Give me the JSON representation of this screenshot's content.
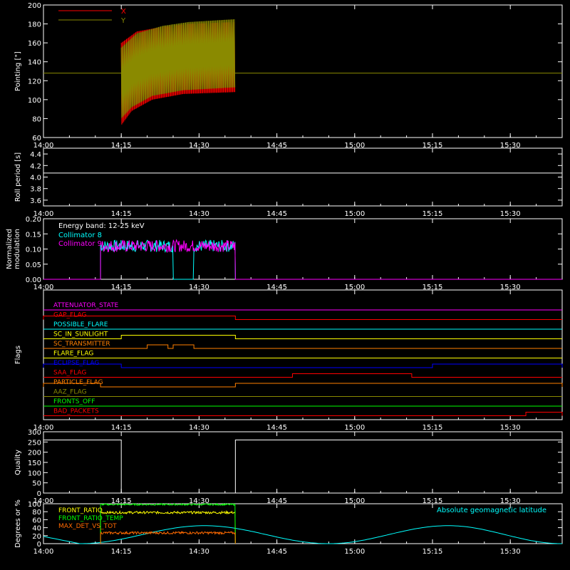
{
  "time_axis": {
    "start": "14:00",
    "end": "15:40",
    "tick_labels": [
      "14:00",
      "14:15",
      "14:30",
      "14:45",
      "15:00",
      "15:15",
      "15:30"
    ]
  },
  "colors": {
    "axis": "#ffffff",
    "red": "#ff0000",
    "olive": "#8a8a00",
    "cyan": "#00ffff",
    "magenta": "#ff00ff",
    "white": "#ffffff",
    "orange": "#ff7f00",
    "yellow": "#ffff00",
    "blue": "#0000ff",
    "green": "#00ff00",
    "dark_orange": "#ff6a00"
  },
  "chart_data": [
    {
      "type": "line",
      "ylabel": "Pointing [\"]",
      "ylim": [
        60,
        200
      ],
      "yticks": [
        60,
        80,
        100,
        120,
        140,
        160,
        180,
        200
      ],
      "legend": [
        "X",
        "Y"
      ],
      "reference_line": 128,
      "series": [
        {
          "name": "X",
          "color": "#ff0000",
          "start": "14:15",
          "end": "14:37",
          "upper_env": [
            [
              0,
              160
            ],
            [
              3,
              172
            ],
            [
              8,
              177
            ],
            [
              13,
              180
            ],
            [
              22,
              182
            ]
          ],
          "lower_env": [
            [
              0,
              73
            ],
            [
              2,
              88
            ],
            [
              6,
              100
            ],
            [
              12,
              106
            ],
            [
              22,
              108
            ]
          ]
        },
        {
          "name": "Y",
          "color": "#8a8a00",
          "start": "14:15",
          "end": "14:37",
          "upper_env": [
            [
              0,
              155
            ],
            [
              3,
              170
            ],
            [
              8,
              178
            ],
            [
              13,
              182
            ],
            [
              22,
              185
            ]
          ],
          "lower_env": [
            [
              0,
              80
            ],
            [
              2,
              92
            ],
            [
              6,
              104
            ],
            [
              12,
              110
            ],
            [
              22,
              113
            ]
          ]
        }
      ]
    },
    {
      "type": "line",
      "ylabel": "Roll period [s]",
      "ylim": [
        3.5,
        4.5
      ],
      "yticks": [
        3.6,
        3.8,
        4.0,
        4.2,
        4.4
      ],
      "series": [
        {
          "color": "#ffffff",
          "value": 4.07
        }
      ]
    },
    {
      "type": "line",
      "ylabel": "Normalized modulation",
      "ylim": [
        0,
        0.2
      ],
      "yticks": [
        0.0,
        0.05,
        0.1,
        0.15,
        0.2
      ],
      "annotation": "Energy band: 12-25 keV",
      "legend": [
        "Collimator 8",
        "Collimator 9"
      ],
      "series": [
        {
          "name": "Collimator 8",
          "color": "#00ffff",
          "start": "14:11",
          "end": "14:37",
          "mean": 0.11,
          "amp": 0.02,
          "gaps": [
            [
              "14:25",
              "14:29"
            ]
          ]
        },
        {
          "name": "Collimator 9",
          "color": "#ff00ff",
          "start": "14:11",
          "end": "14:37",
          "mean": 0.11,
          "amp": 0.02
        }
      ]
    },
    {
      "type": "flags",
      "ylabel": "Flags",
      "flags": [
        {
          "label": "ATTENUATOR_STATE",
          "color": "#ff00ff",
          "highs": []
        },
        {
          "label": "GAP_FLAG",
          "color": "#ff0000",
          "highs": [
            [
              "14:00",
              "14:37"
            ]
          ]
        },
        {
          "label": "POSSIBLE_FLARE",
          "color": "#00ffff",
          "highs": []
        },
        {
          "label": "SC_IN_SUNLIGHT",
          "color": "#ffff00",
          "highs": [
            [
              "14:15",
              "14:37"
            ]
          ]
        },
        {
          "label": "SC_TRANSMITTER",
          "color": "#ff7f00",
          "highs": [
            [
              "14:20",
              "14:24"
            ],
            [
              "14:25",
              "14:29"
            ]
          ]
        },
        {
          "label": "FLARE_FLAG",
          "color": "#ffff00",
          "highs": []
        },
        {
          "label": "ECLIPSE_FLAG",
          "color": "#0000ff",
          "highs": [
            [
              "14:00",
              "14:15"
            ],
            [
              "15:15",
              "15:40"
            ]
          ]
        },
        {
          "label": "SAA_FLAG",
          "color": "#ff0000",
          "highs": [
            [
              "14:48",
              "15:11"
            ]
          ]
        },
        {
          "label": "PARTICLE_FLAG",
          "color": "#ff7f00",
          "highs": [
            [
              "14:00",
              "14:11"
            ],
            [
              "14:37",
              "15:40"
            ]
          ]
        },
        {
          "label": "AAZ_FLAG",
          "color": "#8a8a00",
          "highs": []
        },
        {
          "label": "FRONTS_OFF",
          "color": "#00ff00",
          "highs": []
        },
        {
          "label": "BAD_PACKETS",
          "color": "#ff0000",
          "highs": [
            [
              "15:33",
              "15:40"
            ]
          ]
        }
      ]
    },
    {
      "type": "line",
      "ylabel": "Quality",
      "ylim": [
        0,
        300
      ],
      "yticks": [
        0,
        50,
        100,
        150,
        200,
        250,
        300
      ],
      "series": [
        {
          "color": "#ffffff",
          "segments": [
            [
              "14:00",
              "14:15",
              260
            ],
            [
              "14:15",
              "14:37",
              0
            ],
            [
              "14:37",
              "15:40",
              260
            ]
          ]
        }
      ]
    },
    {
      "type": "line",
      "ylabel": "Degrees or %",
      "ylim": [
        0,
        100
      ],
      "yticks": [
        0,
        20,
        40,
        60,
        80,
        100
      ],
      "legend": [
        "FRONT_RATIO",
        "FRONT_RATIO_TEMP",
        "MAX_DET_VS_TOT"
      ],
      "right_label": "Absolute geomagnetic latitude",
      "series": [
        {
          "name": "FRONT_RATIO",
          "color": "#ffff00",
          "start": "14:11",
          "end": "14:37",
          "mean": 78,
          "amp": 3
        },
        {
          "name": "FRONT_RATIO_TEMP",
          "color": "#00ff00",
          "start": "14:11",
          "end": "14:37",
          "mean": 98,
          "amp": 2
        },
        {
          "name": "MAX_DET_VS_TOT",
          "color": "#ff6a00",
          "start": "14:11",
          "end": "14:37",
          "mean": 27,
          "amp": 3
        },
        {
          "name": "Absolute geomagnetic latitude",
          "color": "#00ffff",
          "peaks": [
            [
              "14:31",
              45
            ],
            [
              "15:18",
              45
            ]
          ],
          "troughs": [
            [
              "14:07",
              0
            ],
            [
              "14:55",
              0
            ],
            [
              "15:40",
              0
            ]
          ]
        }
      ]
    }
  ]
}
